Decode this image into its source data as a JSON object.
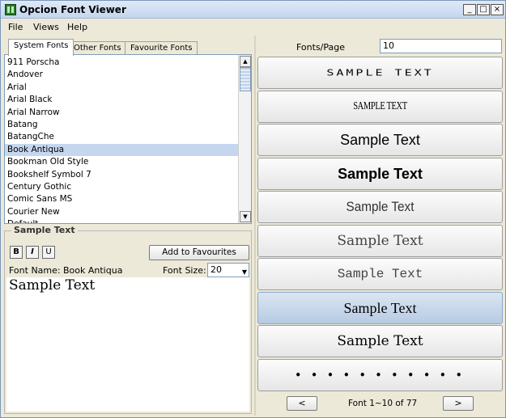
{
  "window": {
    "title": "Opcion Font Viewer",
    "controls": {
      "minimize": "_",
      "maximize": "□",
      "close": "×"
    }
  },
  "menu": [
    "File",
    "Views",
    "Help"
  ],
  "tabs": [
    "System Fonts",
    "Other Fonts",
    "Favourite Fonts"
  ],
  "font_list": {
    "items": [
      "911 Porscha",
      "Andover",
      "Arial",
      "Arial Black",
      "Arial Narrow",
      "Batang",
      "BatangChe",
      "Book Antiqua",
      "Bookman Old Style",
      "Bookshelf Symbol 7",
      "Century Gothic",
      "Comic Sans MS",
      "Courier New",
      "Default"
    ],
    "selected": "Book Antiqua"
  },
  "sample_panel": {
    "title": "Sample Text",
    "bold": "B",
    "italic": "I",
    "underline": "U",
    "add_button": "Add to Favourites",
    "font_name_label": "Font Name:",
    "font_name_value": "Book Antiqua",
    "font_size_label": "Font Size:",
    "font_size_value": "20",
    "preview": "Sample Text"
  },
  "right": {
    "fonts_per_page_label": "Fonts/Page",
    "fonts_per_page_value": "10",
    "samples": [
      "SAMPLE TEXT",
      "SAMPLE TEXT",
      "Sample Text",
      "Sample Text",
      "Sample Text",
      "Sample Text",
      "Sample Text",
      "Sample Text",
      "Sample Text",
      "• • • • • • • • • • •"
    ],
    "selected_index": 7,
    "prev": "<",
    "next": ">",
    "page_status": "Font 1~10 of 77"
  }
}
